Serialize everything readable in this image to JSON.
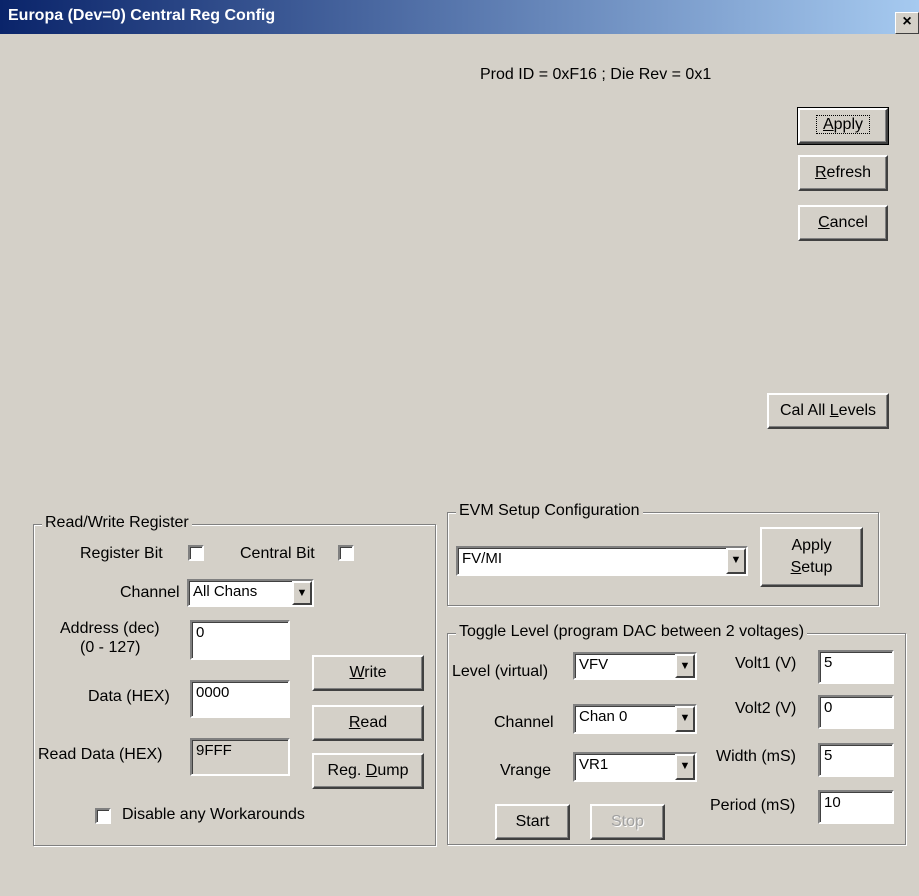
{
  "window": {
    "title": "Europa (Dev=0) Central Reg Config",
    "close": "×"
  },
  "info": {
    "prod_id": "Prod ID = 0xF16 ; Die Rev = 0x1"
  },
  "buttons": {
    "apply": {
      "pre": "",
      "u": "A",
      "post": "pply"
    },
    "refresh": {
      "pre": "",
      "u": "R",
      "post": "efresh"
    },
    "cancel": {
      "pre": "",
      "u": "C",
      "post": "ancel"
    },
    "cal_all": {
      "pre": "Cal All ",
      "u": "L",
      "post": "evels"
    }
  },
  "rw_register": {
    "legend": "Read/Write Register",
    "register_bit_label": "Register Bit",
    "central_bit_label": "Central Bit",
    "channel_label": "Channel",
    "channel_value": "All Chans",
    "address_label_1": "Address (dec)",
    "address_label_2": "(0 - 127)",
    "address_value": "0",
    "data_label": "Data (HEX)",
    "data_value": "0000",
    "read_data_label": "Read Data (HEX)",
    "read_data_value": "9FFF",
    "write": {
      "pre": "",
      "u": "W",
      "post": "rite"
    },
    "read": {
      "pre": "",
      "u": "R",
      "post": "ead"
    },
    "reg_dump": {
      "pre": "Reg. ",
      "u": "D",
      "post": "ump"
    },
    "disable_workarounds": "Disable any Workarounds"
  },
  "evm_setup": {
    "legend": "EVM Setup Configuration",
    "value": "FV/MI",
    "apply_setup_1": "Apply",
    "apply_setup_2": {
      "pre": "",
      "u": "S",
      "post": "etup"
    }
  },
  "toggle": {
    "legend": "Toggle Level (program DAC between 2 voltages)",
    "level_label": "Level (virtual)",
    "level_value": "VFV",
    "channel_label": "Channel",
    "channel_value": "Chan 0",
    "vrange_label": "Vrange",
    "vrange_value": "VR1",
    "volt1_label": "Volt1 (V)",
    "volt1_value": "5",
    "volt2_label": "Volt2 (V)",
    "volt2_value": "0",
    "width_label": "Width (mS)",
    "width_value": "5",
    "period_label": "Period (mS)",
    "period_value": "10",
    "start": "Start",
    "stop": "Stop"
  },
  "icons": {
    "dropdown": "▼"
  }
}
